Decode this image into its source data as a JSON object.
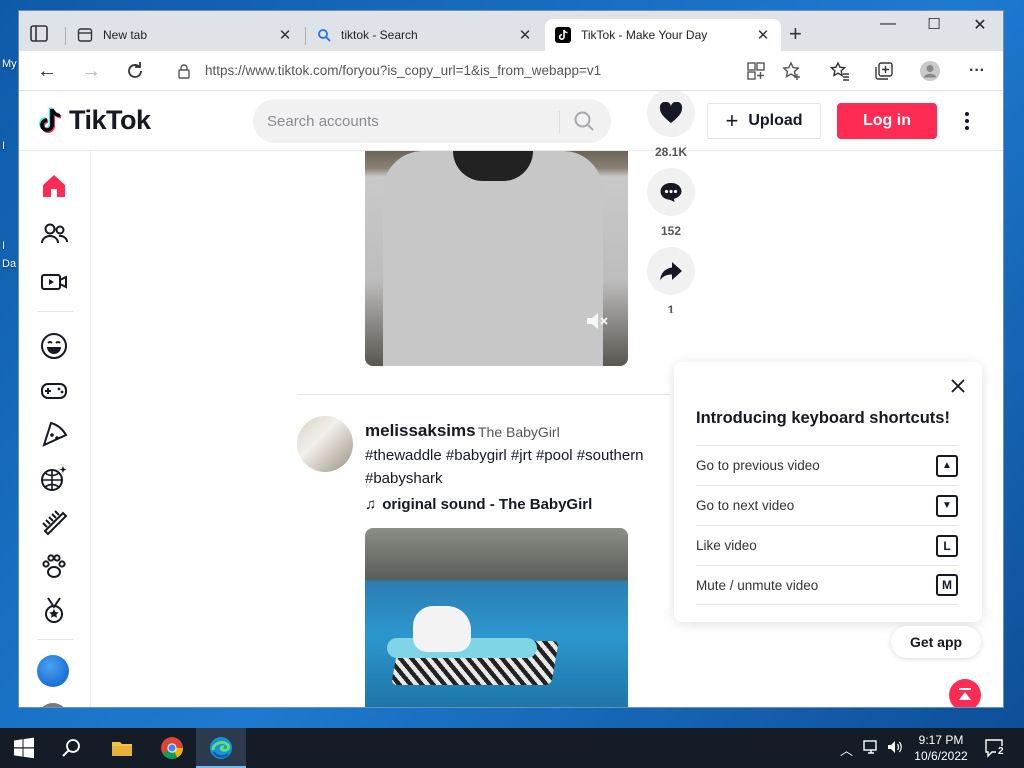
{
  "desktop": {
    "labels": [
      "My",
      "I",
      "I",
      "Da"
    ]
  },
  "browser": {
    "tabs": [
      {
        "title": "New tab",
        "active": false
      },
      {
        "title": "tiktok - Search",
        "active": false
      },
      {
        "title": "TikTok - Make Your Day",
        "active": true
      }
    ],
    "url": "https://www.tiktok.com/foryou?is_copy_url=1&is_from_webapp=v1"
  },
  "tiktok": {
    "logo_text": "TikTok",
    "search_placeholder": "Search accounts",
    "upload_label": "Upload",
    "login_label": "Log in",
    "video1": {
      "likes": "28.1K",
      "comments": "152",
      "shares": "1"
    },
    "post2": {
      "username": "melissaksims",
      "nickname": "The BabyGirl",
      "caption_line1": "#thewaddle #babygirl #jrt #pool #southern",
      "caption_line2": "#babyshark",
      "sound": "original sound - The BabyGirl"
    },
    "shortcuts": {
      "title": "Introducing keyboard shortcuts!",
      "rows": [
        {
          "label": "Go to previous video",
          "key": "▲"
        },
        {
          "label": "Go to next video",
          "key": "▼"
        },
        {
          "label": "Like video",
          "key": "L"
        },
        {
          "label": "Mute / unmute video",
          "key": "M"
        }
      ]
    },
    "get_app_label": "Get app",
    "colors": {
      "accent": "#fe2c55",
      "text": "#161823"
    }
  },
  "taskbar": {
    "time": "9:17 PM",
    "date": "10/6/2022",
    "notifications": "2"
  }
}
